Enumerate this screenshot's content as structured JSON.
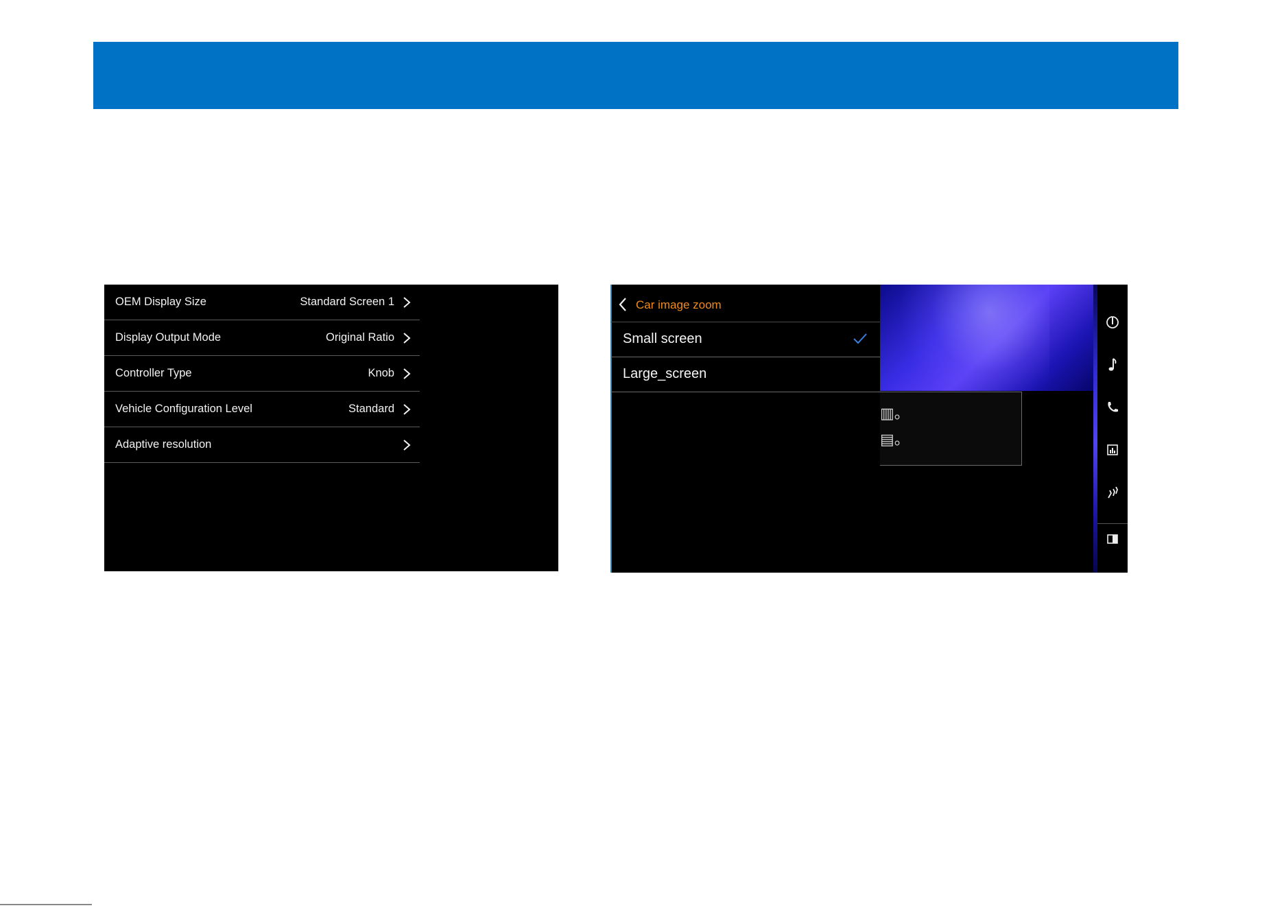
{
  "left_screen": {
    "settings": [
      {
        "label": "OEM Display Size",
        "value": "Standard Screen 1"
      },
      {
        "label": "Display Output Mode",
        "value": "Original Ratio"
      },
      {
        "label": "Controller Type",
        "value": "Knob"
      },
      {
        "label": "Vehicle Configuration Level",
        "value": "Standard"
      },
      {
        "label": "Adaptive resolution",
        "value": ""
      }
    ]
  },
  "right_screen": {
    "title": "Car image zoom",
    "options": [
      {
        "label": "Small screen",
        "selected": true
      },
      {
        "label": "Large_screen",
        "selected": false
      }
    ],
    "popup_glyphs": [
      "▥。",
      "▤。"
    ],
    "rail_icons": [
      "navigation-icon",
      "music-icon",
      "phone-icon",
      "media-icon",
      "seat-heat-icon",
      "split-screen-icon"
    ]
  },
  "colors": {
    "banner": "#0072c6",
    "title_accent": "#f08a1c",
    "check_accent": "#3a7fe0"
  }
}
